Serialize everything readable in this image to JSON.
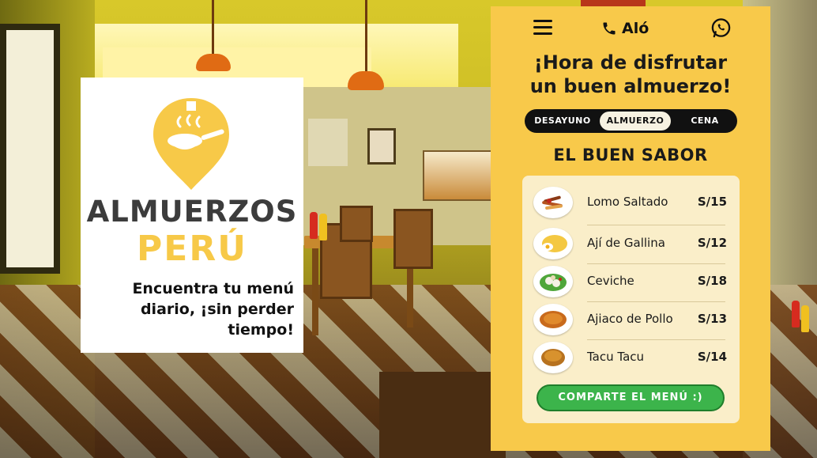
{
  "brand": {
    "name": "ALMUERZOS",
    "country": "PERÚ",
    "tagline": "Encuentra tu menú diario, ¡sin perder tiempo!",
    "colors": {
      "accent": "#f7c948",
      "text": "#3c3c3c"
    }
  },
  "phone": {
    "menu_icon": "hamburger-menu-icon",
    "call_icon": "phone-icon",
    "call_label": "Aló",
    "whatsapp_icon": "whatsapp-icon",
    "headline_line1": "¡Hora de disfrutar",
    "headline_line2": "un buen almuerzo!",
    "tabs": [
      {
        "label": "DESAYUNO",
        "active": false
      },
      {
        "label": "ALMUERZO",
        "active": true
      },
      {
        "label": "CENA",
        "active": false
      }
    ],
    "restaurant_name": "EL BUEN SABOR",
    "menu": [
      {
        "name": "Lomo Saltado",
        "price": "S/15"
      },
      {
        "name": "Ají de Gallina",
        "price": "S/12"
      },
      {
        "name": "Ceviche",
        "price": "S/18"
      },
      {
        "name": "Ajiaco de Pollo",
        "price": "S/13"
      },
      {
        "name": "Tacu Tacu",
        "price": "S/14"
      }
    ],
    "share_button": "COMPARTE EL MENÚ :)",
    "colors": {
      "panel": "#f8c94a",
      "button": "#3cb44b",
      "card": "#faeec9"
    }
  }
}
